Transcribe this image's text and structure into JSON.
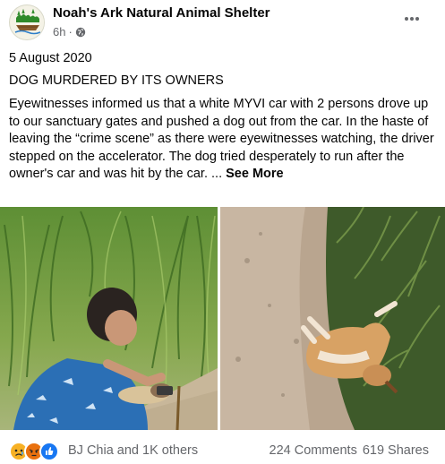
{
  "post": {
    "page_name": "Noah's Ark Natural Animal Shelter",
    "timestamp": "6h",
    "dot": "·",
    "audience_icon": "globe-icon",
    "more_icon": "more-options-icon",
    "date_line": "5 August 2020",
    "headline": "DOG MURDERED BY ITS OWNERS",
    "body": "Eyewitnesses informed us that a white MYVI car with 2 persons  drove up to our sanctuary gates and pushed a dog out from the car. In the haste of leaving the “crime scene” as there were eyewitnesses watching, the driver stepped on the accelerator. The dog tried desperately to run after the owner's car and was hit  by the car. ...",
    "see_more": "See More"
  },
  "photos": [
    {
      "name": "photo-man-with-dog"
    },
    {
      "name": "photo-dog-on-road"
    }
  ],
  "footer": {
    "reactions": [
      {
        "icon": "sad-reaction-icon",
        "color": "#f7b125"
      },
      {
        "icon": "angry-reaction-icon",
        "color": "#e9710f"
      },
      {
        "icon": "like-reaction-icon",
        "color": "#1877f2"
      }
    ],
    "reaction_text": "BJ Chia and 1K others",
    "comments": "224 Comments",
    "shares": "619 Shares"
  }
}
